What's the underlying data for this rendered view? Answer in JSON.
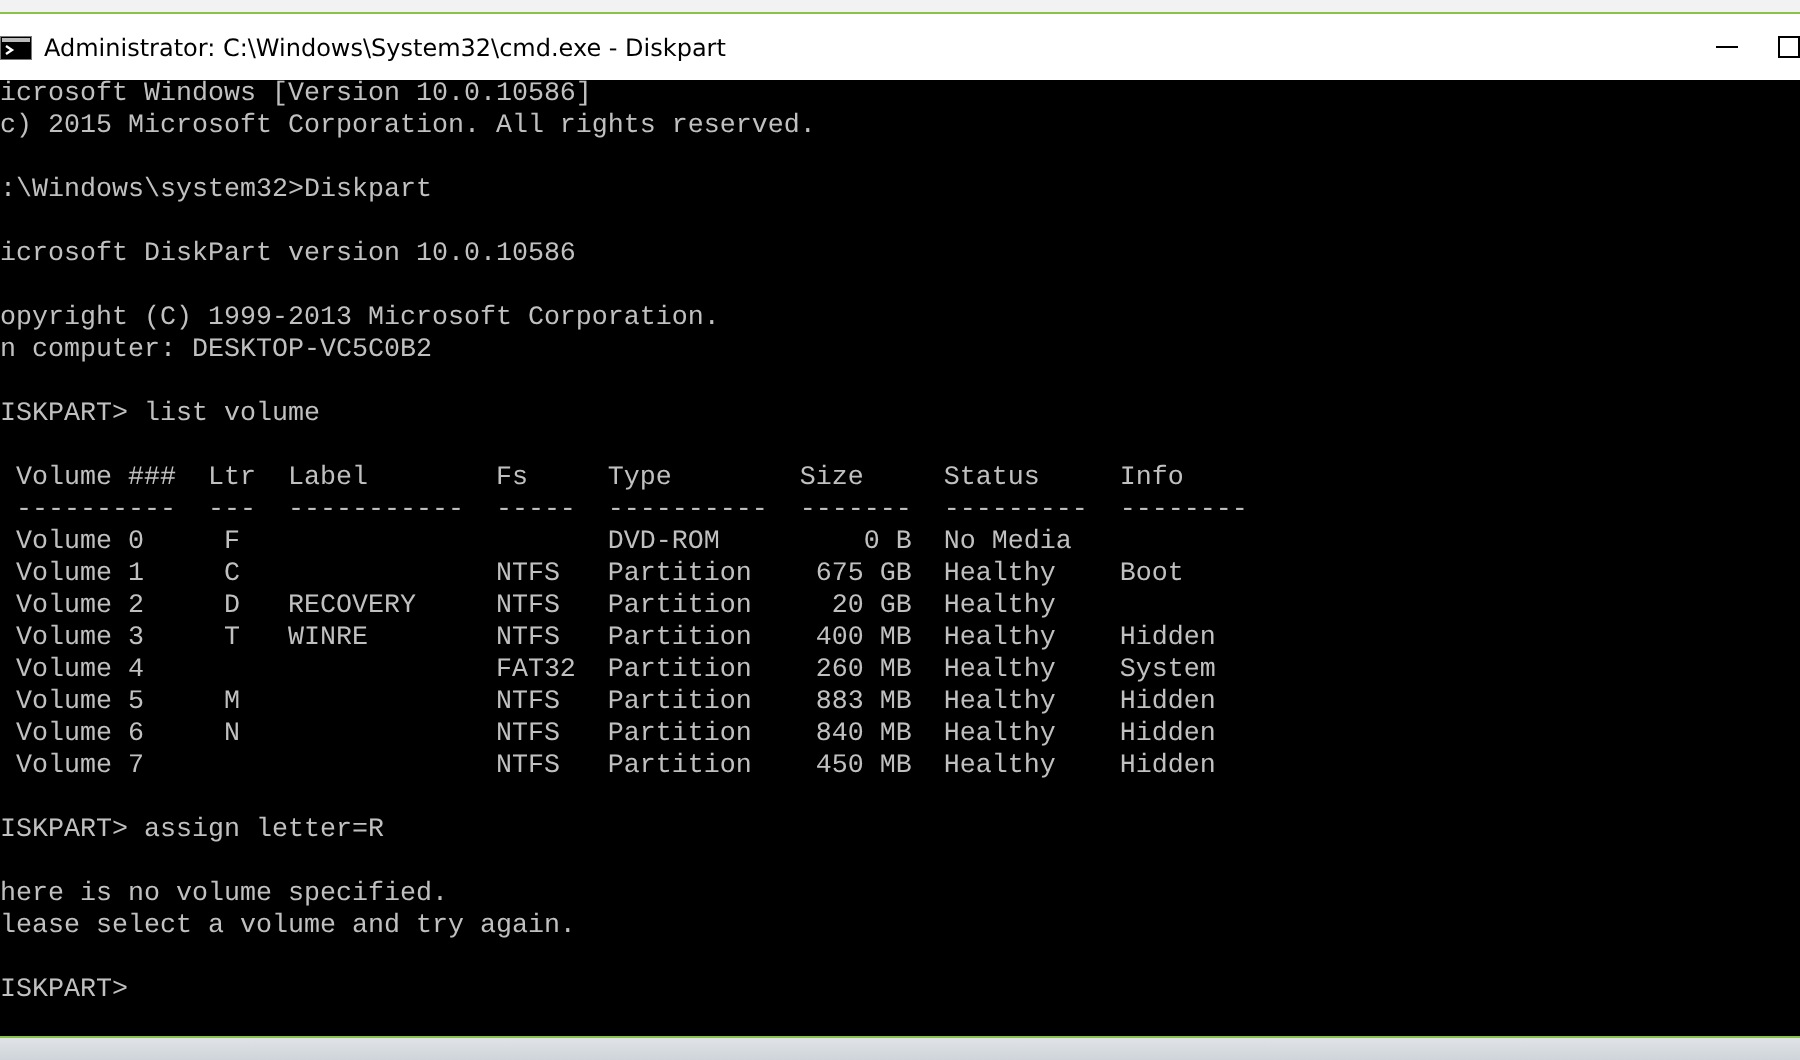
{
  "window": {
    "title": "Administrator: C:\\Windows\\System32\\cmd.exe - Diskpart"
  },
  "console": {
    "blocks": [
      [
        "icrosoft Windows [Version 10.0.10586]",
        "c) 2015 Microsoft Corporation. All rights reserved."
      ],
      [
        ":\\Windows\\system32>Diskpart"
      ],
      [
        "icrosoft DiskPart version 10.0.10586"
      ],
      [
        "opyright (C) 1999-2013 Microsoft Corporation.",
        "n computer: DESKTOP-VC5C0B2"
      ],
      [
        "ISKPART> list volume"
      ],
      [
        " Volume ###  Ltr  Label        Fs     Type        Size     Status     Info",
        " ----------  ---  -----------  -----  ----------  -------  ---------  --------",
        " Volume 0     F                       DVD-ROM         0 B  No Media",
        " Volume 1     C                NTFS   Partition    675 GB  Healthy    Boot",
        " Volume 2     D   RECOVERY     NTFS   Partition     20 GB  Healthy",
        " Volume 3     T   WINRE        NTFS   Partition    400 MB  Healthy    Hidden",
        " Volume 4                      FAT32  Partition    260 MB  Healthy    System",
        " Volume 5     M                NTFS   Partition    883 MB  Healthy    Hidden",
        " Volume 6     N                NTFS   Partition    840 MB  Healthy    Hidden",
        " Volume 7                      NTFS   Partition    450 MB  Healthy    Hidden"
      ],
      [
        "ISKPART> assign letter=R"
      ],
      [
        "here is no volume specified.",
        "lease select a volume and try again."
      ],
      [
        "ISKPART>"
      ]
    ]
  }
}
